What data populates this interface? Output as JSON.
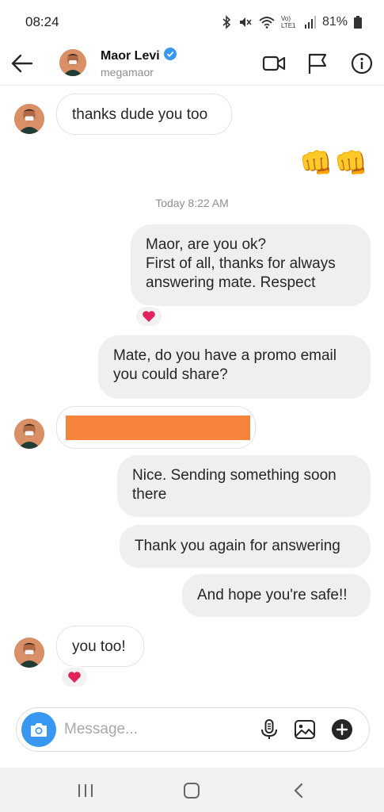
{
  "status_bar": {
    "time": "08:24",
    "network": "Vo) LTE1",
    "battery": "81%"
  },
  "header": {
    "name": "Maor Levi",
    "username": "megamaor",
    "verified": true,
    "icons": [
      "back-arrow-icon",
      "video-call-icon",
      "flag-icon",
      "info-icon"
    ]
  },
  "messages": [
    {
      "from": "them",
      "text": "thanks dude you too"
    },
    {
      "from": "me",
      "emoji": "👊👊"
    },
    {
      "type": "timestamp",
      "text": "Today 8:22 AM"
    },
    {
      "from": "me",
      "lines": [
        "Maor, are you ok?",
        "First of all, thanks for always",
        "answering mate. Respect"
      ],
      "reaction": "❤️"
    },
    {
      "from": "me",
      "lines": [
        "Mate, do you have a promo email",
        "you could share?"
      ]
    },
    {
      "from": "them",
      "redacted": true
    },
    {
      "from": "me",
      "lines": [
        "Nice. Sending something soon",
        "there"
      ]
    },
    {
      "from": "me",
      "text": "Thank you again for answering"
    },
    {
      "from": "me",
      "text": "And hope you're safe!!"
    },
    {
      "from": "them",
      "text": "you too!",
      "reaction": "❤️"
    }
  ],
  "composer": {
    "placeholder": "Message...",
    "icons": [
      "camera-icon",
      "microphone-icon",
      "gallery-icon",
      "add-icon"
    ]
  },
  "navbar": {
    "icons": [
      "recent-apps-icon",
      "home-icon",
      "back-icon"
    ]
  },
  "colors": {
    "accent": "#3897f0",
    "redacted": "#f5833a",
    "outgoing_bubble": "#efefef",
    "heart": "#e0245e"
  }
}
